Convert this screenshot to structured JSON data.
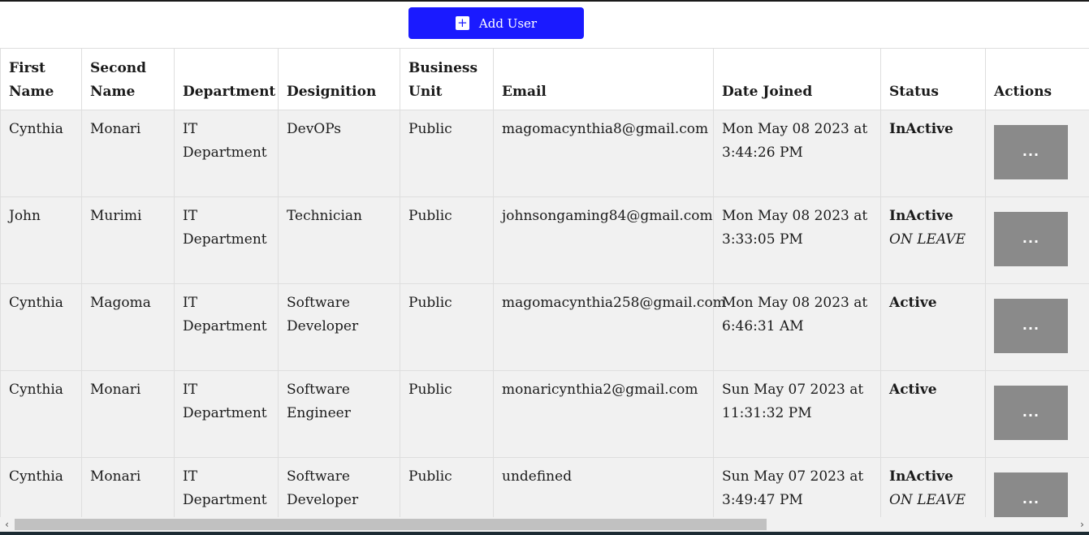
{
  "toolbar": {
    "add_user_label": "Add User",
    "add_icon": "plus-icon"
  },
  "table": {
    "headers": [
      "First Name",
      "Second Name",
      "Department",
      "Designition",
      "Business Unit",
      "Email",
      "Date Joined",
      "Status",
      "Actions"
    ],
    "rows": [
      {
        "first_name": "Cynthia",
        "second_name": "Monari",
        "department": "IT Department",
        "designation": "DevOPs",
        "business_unit": "Public",
        "email": "magomacynthia8@gmail.com",
        "date_joined": "Mon May 08 2023 at 3:44:26 PM",
        "status": "InActive",
        "status_note": "",
        "action_label": "..."
      },
      {
        "first_name": "John",
        "second_name": "Murimi",
        "department": "IT Department",
        "designation": "Technician",
        "business_unit": "Public",
        "email": "johnsongaming84@gmail.com",
        "date_joined": "Mon May 08 2023 at 3:33:05 PM",
        "status": "InActive",
        "status_note": "ON LEAVE",
        "action_label": "..."
      },
      {
        "first_name": "Cynthia",
        "second_name": "Magoma",
        "department": "IT Department",
        "designation": "Software Developer",
        "business_unit": "Public",
        "email": "magomacynthia258@gmail.com",
        "date_joined": "Mon May 08 2023 at 6:46:31 AM",
        "status": "Active",
        "status_note": "",
        "action_label": "..."
      },
      {
        "first_name": "Cynthia",
        "second_name": "Monari",
        "department": "IT Department",
        "designation": "Software Engineer",
        "business_unit": "Public",
        "email": "monaricynthia2@gmail.com",
        "date_joined": "Sun May 07 2023 at 11:31:32 PM",
        "status": "Active",
        "status_note": "",
        "action_label": "..."
      },
      {
        "first_name": "Cynthia",
        "second_name": "Monari",
        "department": "IT Department",
        "designation": "Software Developer",
        "business_unit": "Public",
        "email": "undefined",
        "date_joined": "Sun May 07 2023 at 3:49:47 PM",
        "status": "InActive",
        "status_note": "ON LEAVE",
        "action_label": "..."
      }
    ]
  },
  "scrollbar": {
    "left_arrow": "‹",
    "right_arrow": "›"
  },
  "colors": {
    "accent": "#1a1aff",
    "action_button": "#8a8a8a",
    "row_background": "#f1f1f1"
  }
}
